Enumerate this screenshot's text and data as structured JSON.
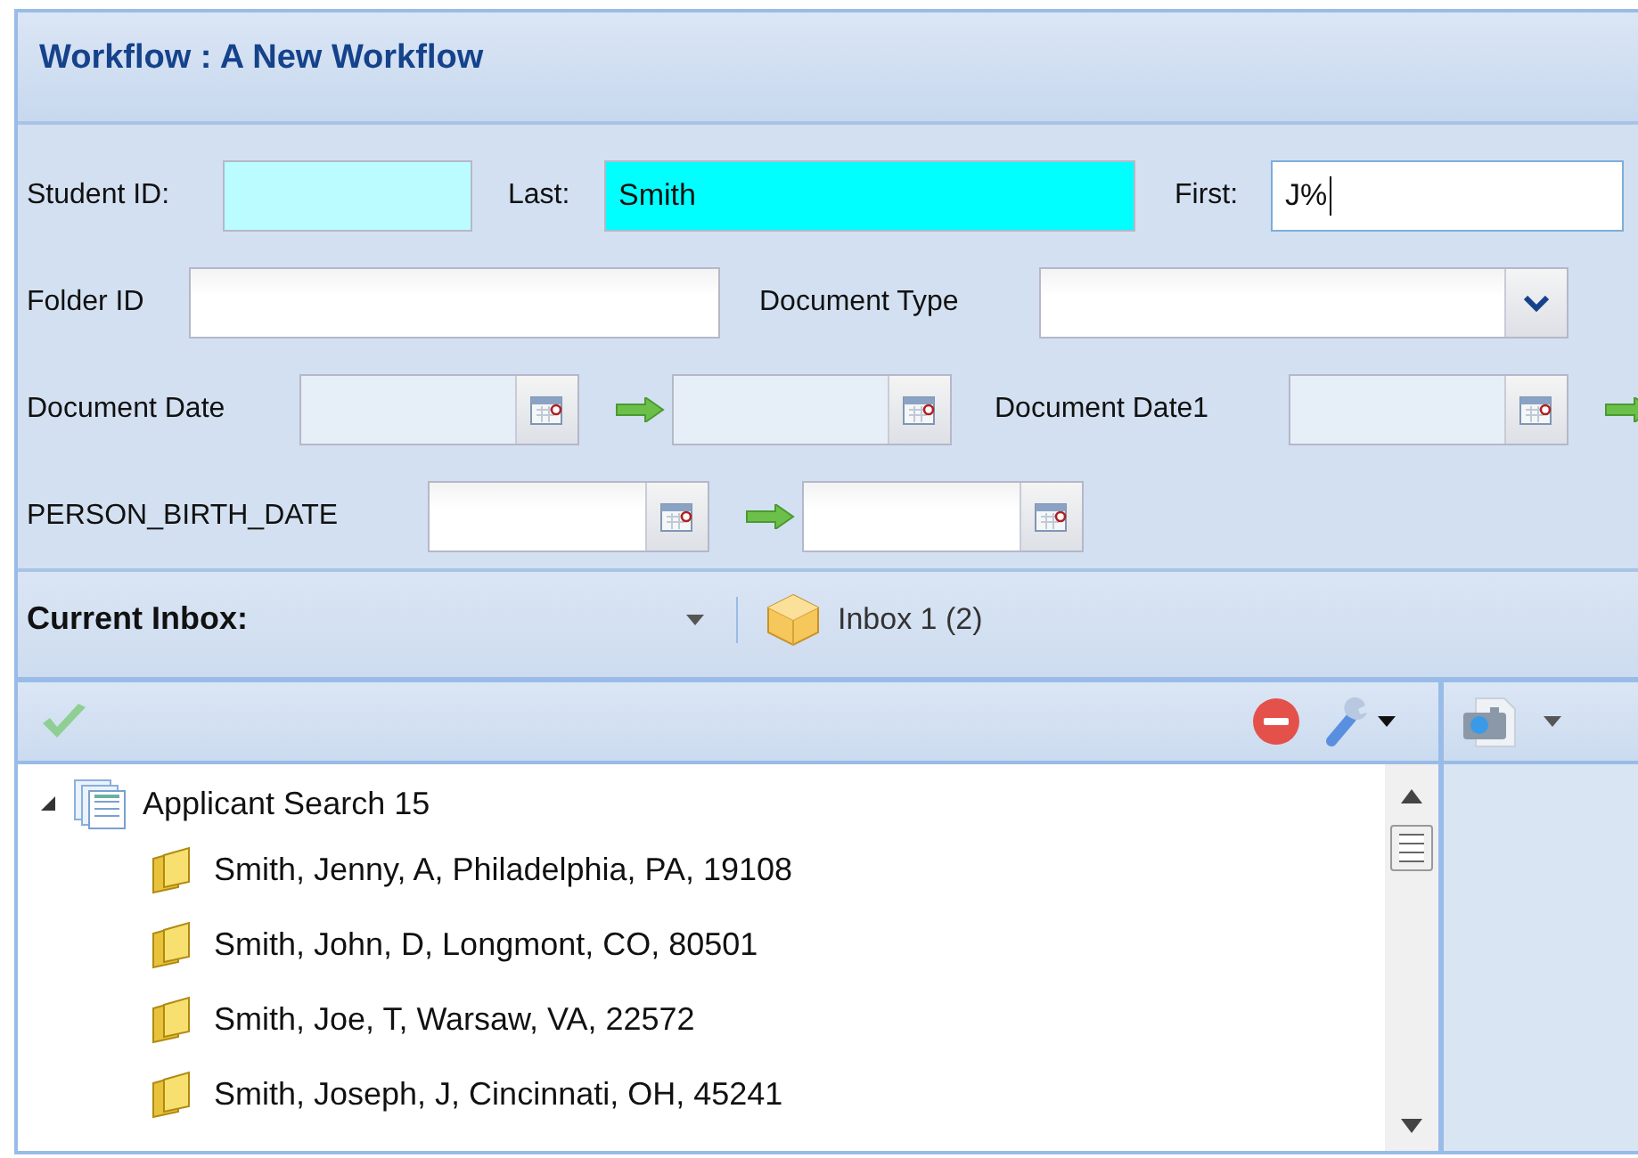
{
  "window": {
    "title": "Workflow : A New Workflow"
  },
  "form_rows": [
    [
      {
        "kind": "text",
        "label": "Student ID:",
        "color": "#bafcff",
        "focused": false
      },
      {
        "kind": "text",
        "label": "Last:",
        "value": "Smith",
        "color": "#00ffff",
        "focused": false
      },
      {
        "kind": "text",
        "label": "First:",
        "value": "J%",
        "focused": true
      }
    ],
    [
      {
        "kind": "text",
        "label": "Folder ID",
        "focused": false
      },
      {
        "kind": "select",
        "label": "Document Type"
      }
    ],
    [
      {
        "kind": "daterange",
        "label": "Document Date",
        "disabled": true
      },
      {
        "kind": "daterange",
        "label": "Document Date1",
        "disabled": true,
        "cut_off": true
      }
    ],
    [
      {
        "kind": "daterange",
        "label": "PERSON_BIRTH_DATE",
        "disabled": false
      }
    ]
  ],
  "inbox_bar": {
    "label": "Current Inbox:",
    "inbox": "Inbox 1 (2)"
  },
  "tree": {
    "label": "Applicant Search 15",
    "expanded": true,
    "children": [
      {
        "label": "Smith, Jenny, A, Philadelphia, PA, 19108"
      },
      {
        "label": "Smith, John, D, Longmont, CO, 80501"
      },
      {
        "label": "Smith, Joe, T, Warsaw, VA, 22572"
      },
      {
        "label": "Smith, Joseph, J, Cincinnati, OH, 45241"
      }
    ]
  }
}
